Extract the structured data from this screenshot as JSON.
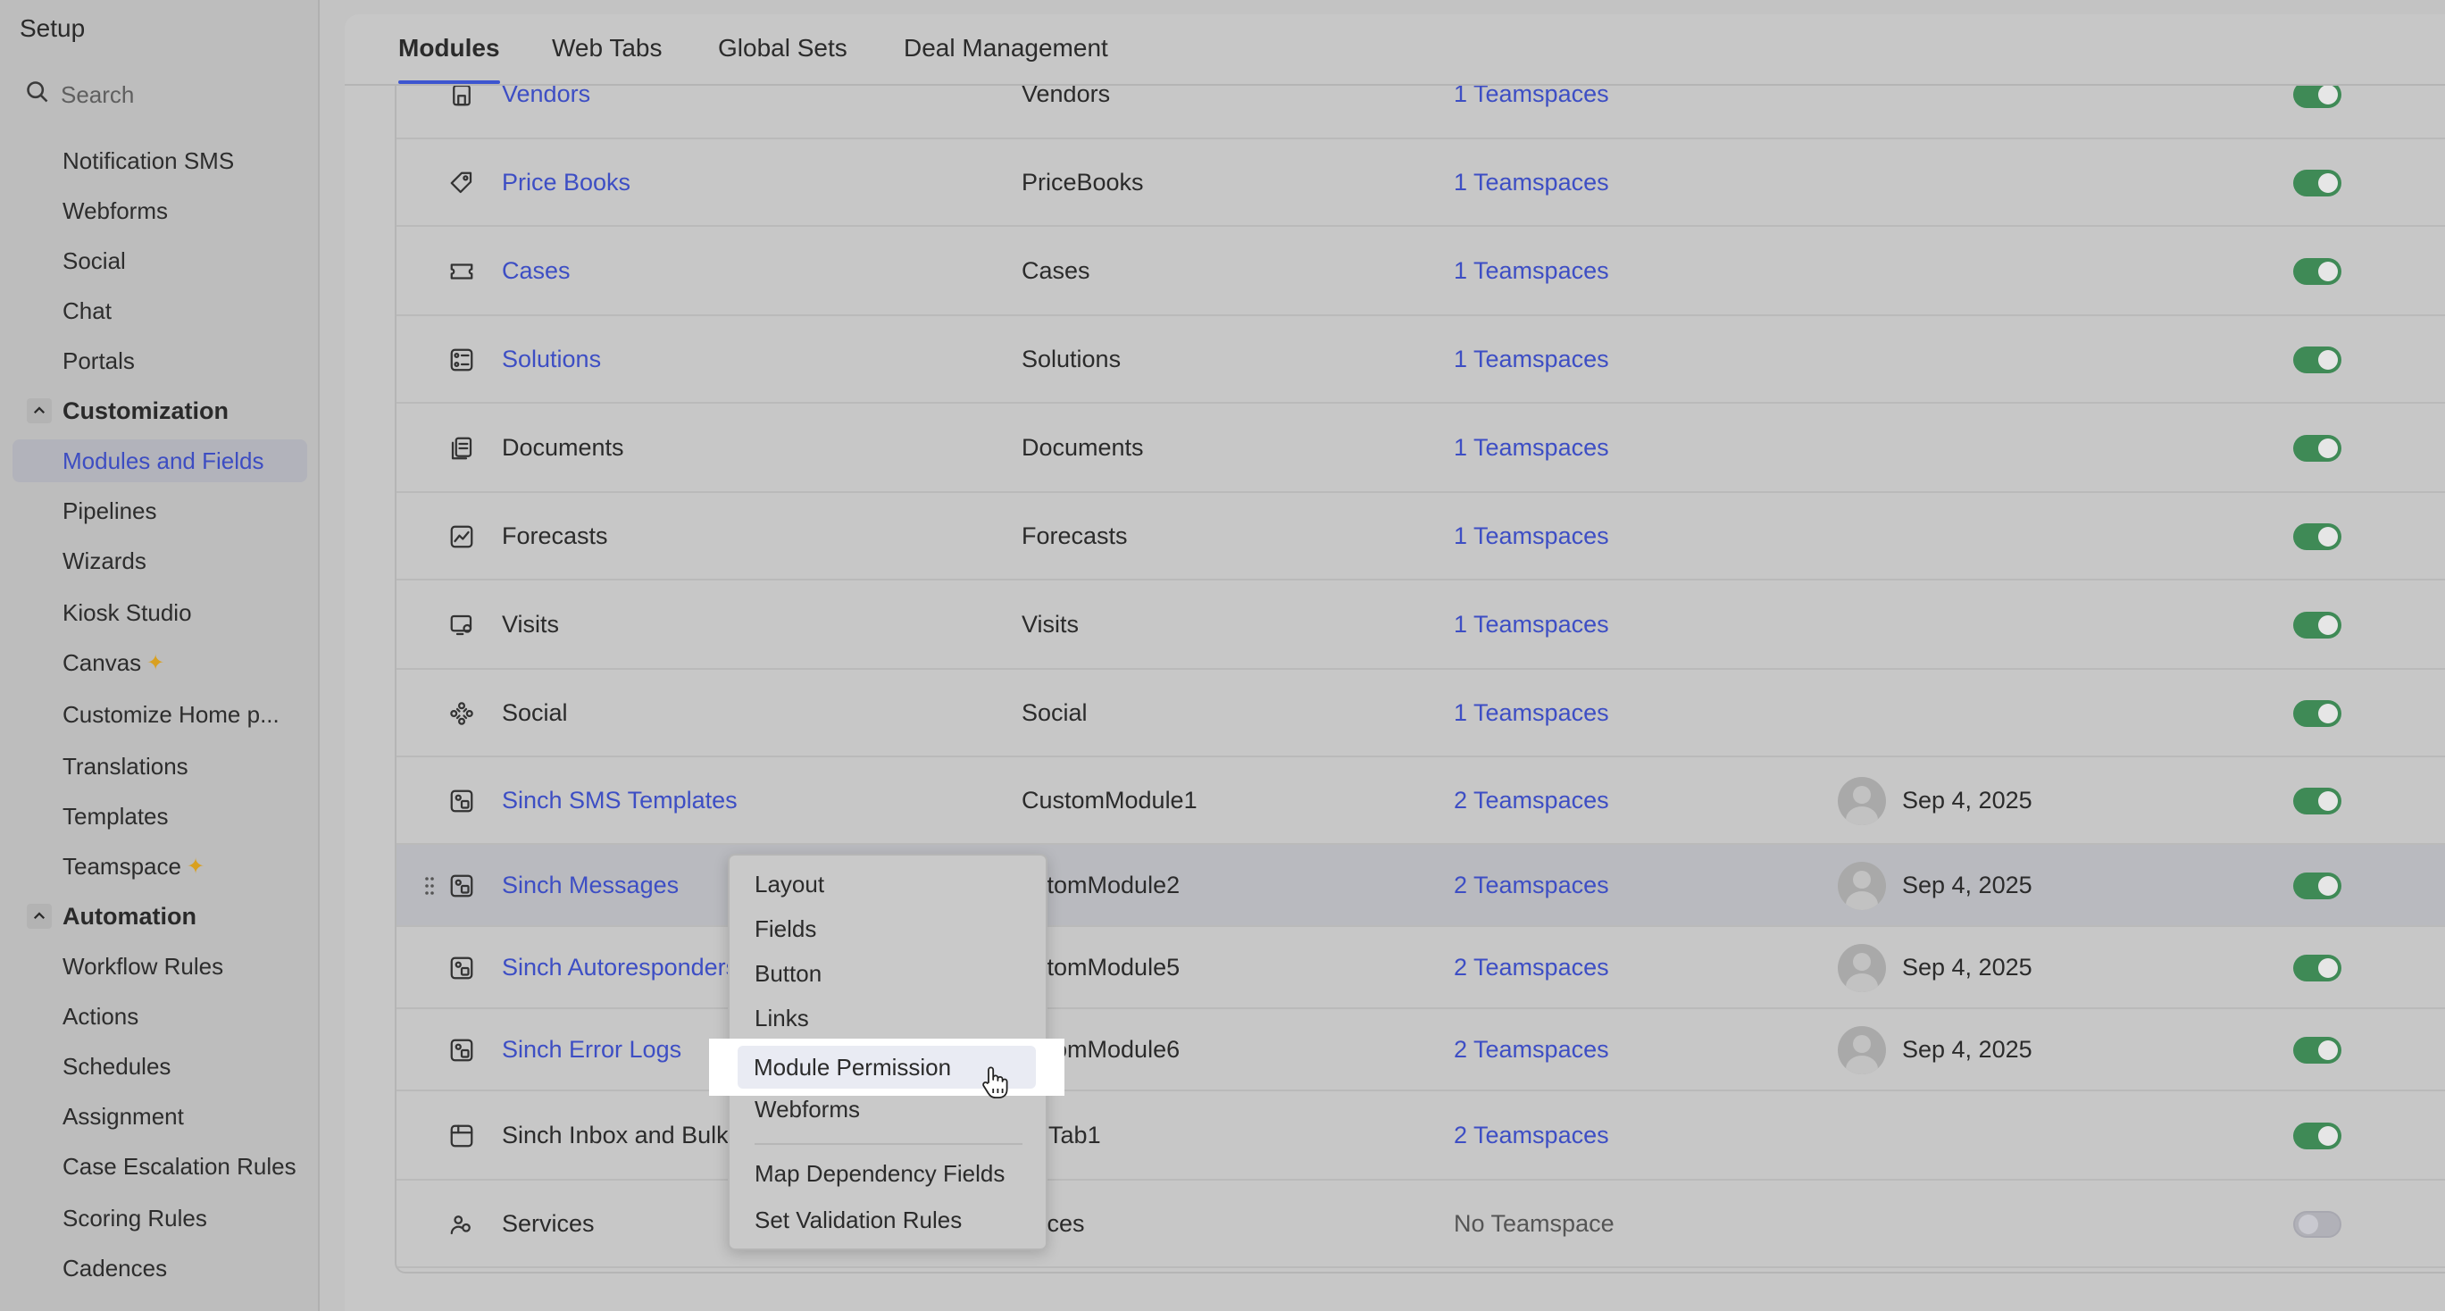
{
  "sidebar": {
    "title": "Setup",
    "search_placeholder": "Search",
    "items": [
      {
        "label": "Notification SMS"
      },
      {
        "label": "Webforms"
      },
      {
        "label": "Social"
      },
      {
        "label": "Chat"
      },
      {
        "label": "Portals"
      }
    ],
    "customization": {
      "label": "Customization",
      "items": [
        {
          "label": "Modules and Fields",
          "active": true
        },
        {
          "label": "Pipelines"
        },
        {
          "label": "Wizards"
        },
        {
          "label": "Kiosk Studio"
        },
        {
          "label": "Canvas",
          "new": true
        },
        {
          "label": "Customize Home p..."
        },
        {
          "label": "Translations"
        },
        {
          "label": "Templates"
        },
        {
          "label": "Teamspace",
          "new": true
        }
      ]
    },
    "automation": {
      "label": "Automation",
      "items": [
        {
          "label": "Workflow Rules"
        },
        {
          "label": "Actions"
        },
        {
          "label": "Schedules"
        },
        {
          "label": "Assignment"
        },
        {
          "label": "Case Escalation Rules"
        },
        {
          "label": "Scoring Rules"
        },
        {
          "label": "Cadences"
        }
      ]
    }
  },
  "tabs": [
    {
      "label": "Modules",
      "active": true
    },
    {
      "label": "Web Tabs"
    },
    {
      "label": "Global Sets"
    },
    {
      "label": "Deal Management"
    }
  ],
  "rows": [
    {
      "name": "Vendors",
      "api": "Vendors",
      "teamspaces": "1 Teamspaces",
      "link": true,
      "enabled": true,
      "icon": "building-icon"
    },
    {
      "name": "Price Books",
      "api": "PriceBooks",
      "teamspaces": "1 Teamspaces",
      "link": true,
      "enabled": true,
      "icon": "tag-icon"
    },
    {
      "name": "Cases",
      "api": "Cases",
      "teamspaces": "1 Teamspaces",
      "link": true,
      "enabled": true,
      "icon": "ticket-icon"
    },
    {
      "name": "Solutions",
      "api": "Solutions",
      "teamspaces": "1 Teamspaces",
      "link": true,
      "enabled": true,
      "icon": "solutions-icon"
    },
    {
      "name": "Documents",
      "api": "Documents",
      "teamspaces": "1 Teamspaces",
      "link": false,
      "enabled": true,
      "icon": "documents-icon"
    },
    {
      "name": "Forecasts",
      "api": "Forecasts",
      "teamspaces": "1 Teamspaces",
      "link": false,
      "enabled": true,
      "icon": "forecast-icon"
    },
    {
      "name": "Visits",
      "api": "Visits",
      "teamspaces": "1 Teamspaces",
      "link": false,
      "enabled": true,
      "icon": "visits-icon"
    },
    {
      "name": "Social",
      "api": "Social",
      "teamspaces": "1 Teamspaces",
      "link": false,
      "enabled": true,
      "icon": "social-icon"
    },
    {
      "name": "Sinch SMS Templates",
      "api": "CustomModule1",
      "teamspaces": "2 Teamspaces",
      "link": true,
      "enabled": true,
      "date": "Sep 4, 2025",
      "icon": "custom-module-icon"
    },
    {
      "name": "Sinch Messages",
      "api": "ustomModule2",
      "teamspaces": "2 Teamspaces",
      "link": true,
      "enabled": true,
      "date": "Sep 4, 2025",
      "icon": "custom-module-icon"
    },
    {
      "name": "Sinch Autoresponders",
      "api": "ustomModule5",
      "teamspaces": "2 Teamspaces",
      "link": true,
      "enabled": true,
      "date": "Sep 4, 2025",
      "icon": "custom-module-icon"
    },
    {
      "name": "Sinch Error Logs",
      "api": "ustomModule6",
      "teamspaces": "2 Teamspaces",
      "link": true,
      "enabled": true,
      "date": "Sep 4, 2025",
      "icon": "custom-module-icon"
    },
    {
      "name": "Sinch Inbox and Bulk S",
      "api": "ebTab1",
      "teamspaces": "2 Teamspaces",
      "link": false,
      "enabled": true,
      "icon": "webtab-icon"
    },
    {
      "name": "Services",
      "api": "rvices",
      "teamspaces": "No Teamspace",
      "link": false,
      "enabled": false,
      "icon": "services-icon"
    }
  ],
  "more_button": "···",
  "menu": {
    "items": [
      "Layout",
      "Fields",
      "Button",
      "Links",
      "Module Permission",
      "Webforms"
    ],
    "extra_items": [
      "Map Dependency Fields",
      "Set Validation Rules"
    ],
    "highlighted": "Module Permission"
  },
  "colors": {
    "link": "#3d4ec4",
    "toggle_on": "#3f8a56",
    "active_tab_underline": "#3d55d0"
  }
}
